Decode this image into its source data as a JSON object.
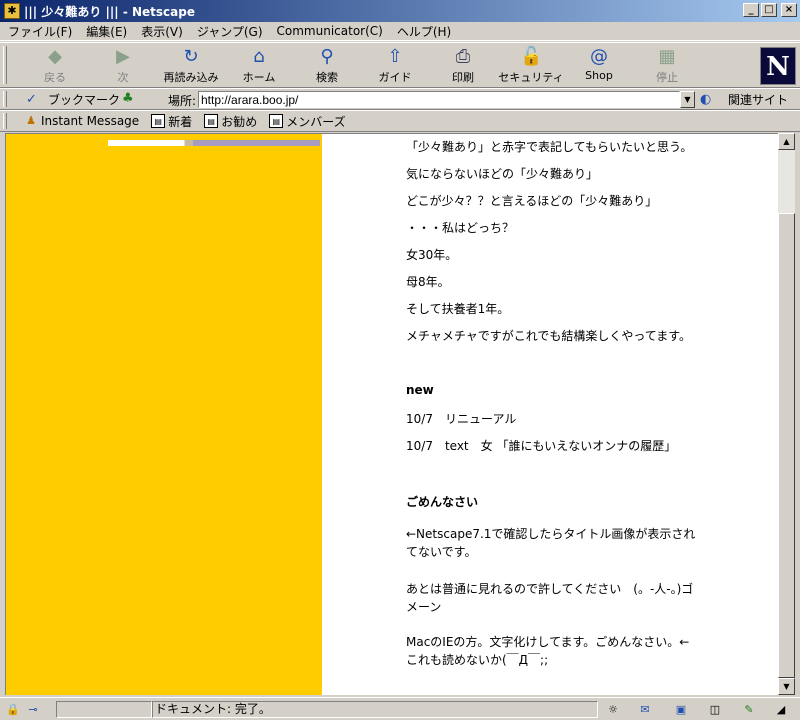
{
  "window": {
    "title": "||| 少々難あり |||  - Netscape"
  },
  "menu": [
    "ファイル(F)",
    "編集(E)",
    "表示(V)",
    "ジャンプ(G)",
    "Communicator(C)",
    "ヘルプ(H)"
  ],
  "toolbar": [
    {
      "label": "戻る",
      "icon": "back-icon",
      "disabled": true
    },
    {
      "label": "次",
      "icon": "forward-icon",
      "disabled": true
    },
    {
      "label": "再読み込み",
      "icon": "reload-icon",
      "disabled": false
    },
    {
      "label": "ホーム",
      "icon": "home-icon",
      "disabled": false
    },
    {
      "label": "検索",
      "icon": "search-icon",
      "disabled": false
    },
    {
      "label": "ガイド",
      "icon": "guide-icon",
      "disabled": false
    },
    {
      "label": "印刷",
      "icon": "print-icon",
      "disabled": false
    },
    {
      "label": "セキュリティ",
      "icon": "security-icon",
      "disabled": false
    },
    {
      "label": "Shop",
      "icon": "shop-icon",
      "disabled": false
    },
    {
      "label": "停止",
      "icon": "stop-icon",
      "disabled": true
    }
  ],
  "location": {
    "bookmarks_label": "ブックマーク",
    "label": "場所:",
    "url": "http://arara.boo.jp/",
    "related_label": "関連サイト"
  },
  "personal_toolbar": [
    "Instant Message",
    "新着",
    "お勧め",
    "メンバーズ"
  ],
  "content": {
    "lines": [
      "「少々難あり」と赤字で表記してもらいたいと思う。",
      "気にならないほどの「少々難あり」",
      "どこが少々？？と言えるほどの「少々難あり」",
      "・・・私はどっち？",
      "女30年。",
      "母8年。",
      "そして扶養者1年。",
      "メチャメチャですがこれでも結構楽しくやってます。"
    ],
    "new_heading": "new",
    "updates": [
      "10/7　リニューアル",
      "10/7　text　女 「誰にもいえないオンナの履歴」"
    ],
    "sorry_heading": "ごめんなさい",
    "sorry_paragraphs": [
      "←Netscape7.1で確認したらタイトル画像が表示されてないです。",
      "あとは普通に見れるので許してください　(。-人-。)ゴメーン",
      "MacのIEの方。文字化けしてます。ごめんなさい。←これも読めないか(￣Д￣;;"
    ]
  },
  "status": {
    "text": "ドキュメント: 完了。"
  },
  "colors": {
    "sidebar_yellow": "#ffcc00",
    "title_gradient_start": "#0a246a",
    "chrome": "#d4d0c8"
  }
}
